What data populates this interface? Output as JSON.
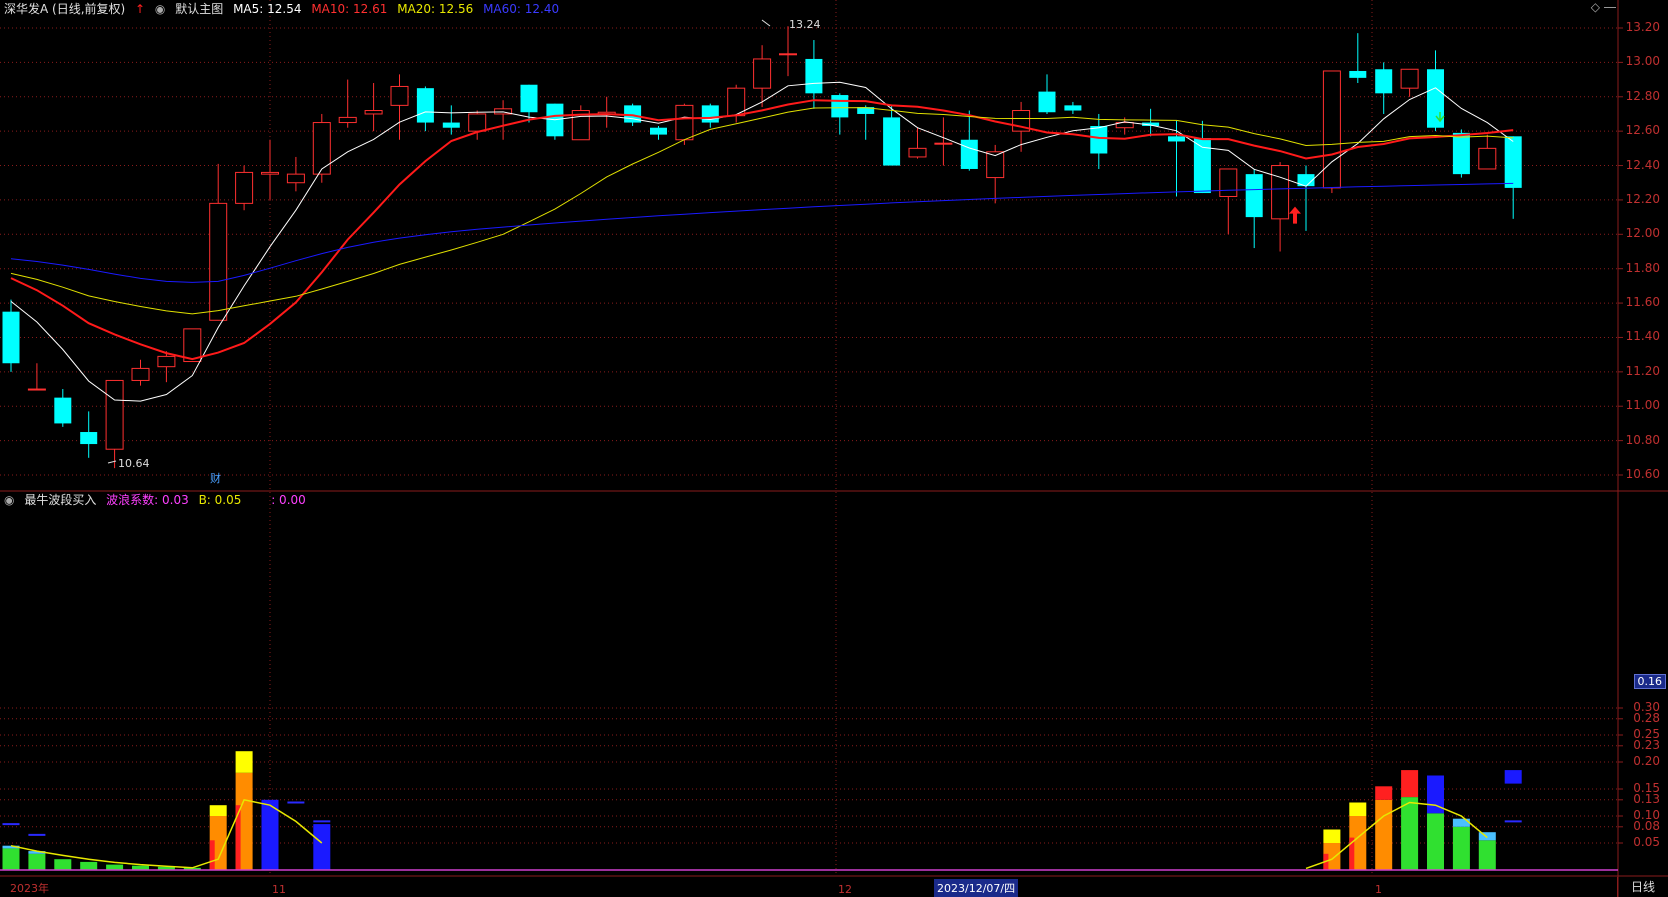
{
  "header": {
    "stock": "深华发A (日线,前复权)",
    "template": "默认主图",
    "ma5": "MA5: 12.54",
    "ma10": "MA10: 12.61",
    "ma20": "MA20: 12.56",
    "ma60": "MA60: 12.40"
  },
  "indicator_header": {
    "name": "最牛波段买入",
    "coef": "波浪系数: 0.03",
    "b": "B: 0.05",
    "c": ": 0.00"
  },
  "price_axis": [
    "13.20",
    "13.00",
    "12.80",
    "12.60",
    "12.40",
    "12.20",
    "12.00",
    "11.80",
    "11.60",
    "11.40",
    "11.20",
    "11.00",
    "10.80",
    "10.60"
  ],
  "ind_axis": [
    "0.30",
    "0.28",
    "0.25",
    "0.23",
    "0.20",
    "0.15",
    "0.13",
    "0.10",
    "0.08",
    "0.05"
  ],
  "current_indicator": "0.16",
  "annotations": {
    "high": "13.24",
    "low": "10.64",
    "finance": "财"
  },
  "x_axis": {
    "year": "2023年",
    "m11": "11",
    "m12": "12",
    "m1": "1",
    "cursor_date": "2023/12/07/四"
  },
  "period": "日线",
  "colors": {
    "up": "#ff3030",
    "down": "#00ffff",
    "ma5": "#ffffff",
    "ma10": "#ff1a1a",
    "ma20": "#e0e000",
    "ma60": "#1a1aff",
    "grid": "#8a1c1c"
  },
  "chart_data": {
    "type": "candlestick",
    "candles": [
      [
        11.55,
        11.25,
        11.62,
        11.2
      ],
      [
        11.1,
        11.1,
        11.25,
        11.1
      ],
      [
        11.05,
        10.9,
        11.1,
        10.88
      ],
      [
        10.85,
        10.78,
        10.97,
        10.7
      ],
      [
        10.75,
        11.15,
        11.15,
        10.64
      ],
      [
        11.15,
        11.22,
        11.27,
        11.12
      ],
      [
        11.23,
        11.29,
        11.32,
        11.14
      ],
      [
        11.26,
        11.45,
        11.45,
        11.26
      ],
      [
        11.5,
        12.18,
        12.41,
        11.5
      ],
      [
        12.18,
        12.36,
        12.4,
        12.14
      ],
      [
        12.35,
        12.36,
        12.55,
        12.2
      ],
      [
        12.3,
        12.35,
        12.45,
        12.25
      ],
      [
        12.35,
        12.65,
        12.7,
        12.3
      ],
      [
        12.65,
        12.68,
        12.9,
        12.62
      ],
      [
        12.7,
        12.72,
        12.88,
        12.6
      ],
      [
        12.75,
        12.86,
        12.93,
        12.55
      ],
      [
        12.85,
        12.65,
        12.86,
        12.6
      ],
      [
        12.65,
        12.62,
        12.75,
        12.58
      ],
      [
        12.6,
        12.7,
        12.72,
        12.55
      ],
      [
        12.7,
        12.73,
        12.78,
        12.55
      ],
      [
        12.87,
        12.71,
        12.87,
        12.65
      ],
      [
        12.76,
        12.57,
        12.76,
        12.55
      ],
      [
        12.55,
        12.72,
        12.75,
        12.55
      ],
      [
        12.7,
        12.71,
        12.8,
        12.62
      ],
      [
        12.75,
        12.65,
        12.76,
        12.63
      ],
      [
        12.62,
        12.58,
        12.63,
        12.55
      ],
      [
        12.55,
        12.75,
        12.76,
        12.52
      ],
      [
        12.75,
        12.65,
        12.76,
        12.62
      ],
      [
        12.69,
        12.85,
        12.87,
        12.65
      ],
      [
        12.85,
        13.02,
        13.1,
        12.74
      ],
      [
        13.05,
        13.05,
        13.21,
        12.92
      ],
      [
        13.02,
        12.82,
        13.13,
        12.73
      ],
      [
        12.81,
        12.68,
        12.82,
        12.58
      ],
      [
        12.74,
        12.7,
        12.75,
        12.55
      ],
      [
        12.68,
        12.4,
        12.75,
        12.4
      ],
      [
        12.45,
        12.5,
        12.62,
        12.44
      ],
      [
        12.53,
        12.53,
        12.68,
        12.4
      ],
      [
        12.55,
        12.38,
        12.72,
        12.37
      ],
      [
        12.33,
        12.48,
        12.52,
        12.18
      ],
      [
        12.6,
        12.72,
        12.77,
        12.48
      ],
      [
        12.83,
        12.71,
        12.93,
        12.7
      ],
      [
        12.75,
        12.72,
        12.77,
        12.7
      ],
      [
        12.63,
        12.47,
        12.7,
        12.38
      ],
      [
        12.62,
        12.65,
        12.68,
        12.58
      ],
      [
        12.65,
        12.63,
        12.73,
        12.57
      ],
      [
        12.57,
        12.54,
        12.66,
        12.22
      ],
      [
        12.56,
        12.24,
        12.66,
        12.24
      ],
      [
        12.22,
        12.38,
        12.38,
        12.0
      ],
      [
        12.35,
        12.1,
        12.38,
        11.92
      ],
      [
        12.09,
        12.4,
        12.42,
        11.9
      ],
      [
        12.35,
        12.28,
        12.4,
        12.02
      ],
      [
        12.27,
        12.95,
        12.95,
        12.24
      ],
      [
        12.95,
        12.91,
        13.17,
        12.88
      ],
      [
        12.96,
        12.82,
        13.0,
        12.7
      ],
      [
        12.85,
        12.96,
        12.96,
        12.8
      ],
      [
        12.96,
        12.62,
        13.07,
        12.6
      ],
      [
        12.59,
        12.35,
        12.61,
        12.33
      ],
      [
        12.38,
        12.5,
        12.58,
        12.38
      ],
      [
        12.57,
        12.27,
        12.57,
        12.09
      ]
    ]
  }
}
